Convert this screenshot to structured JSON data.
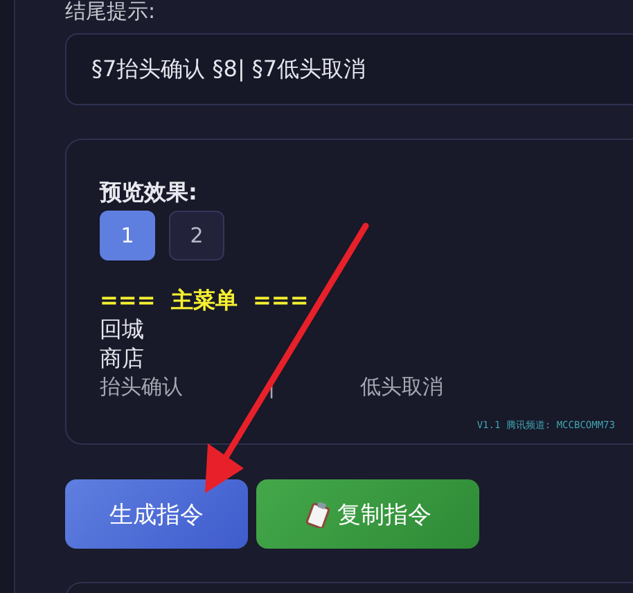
{
  "end_hint": {
    "label": "结尾提示:",
    "value": "§7抬头确认 §8| §7低头取消"
  },
  "preview": {
    "title": "预览效果:",
    "pages": [
      {
        "label": "1",
        "selected": true
      },
      {
        "label": "2",
        "selected": false
      }
    ],
    "lines": [
      {
        "kind": "header",
        "text": "===  主菜单  ==="
      },
      {
        "kind": "item",
        "text": "回城"
      },
      {
        "kind": "item",
        "text": "商店"
      },
      {
        "kind": "hint",
        "text": "抬头确认  |  低头取消"
      }
    ],
    "footer": "V1.1 腾讯频道: MCCBCOMM73"
  },
  "buttons": [
    {
      "kind": "primary",
      "label": "生成指令"
    },
    {
      "kind": "success",
      "label": "复制指令"
    }
  ]
}
